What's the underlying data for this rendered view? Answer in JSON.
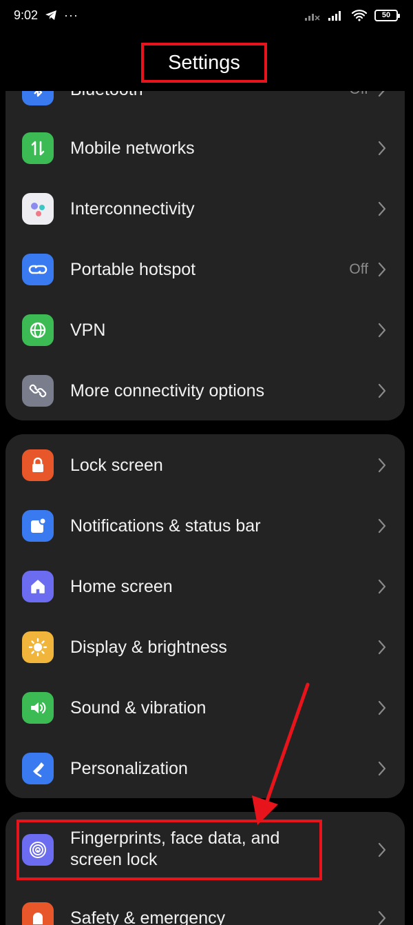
{
  "status_bar": {
    "time": "9:02",
    "dots": "···",
    "battery": "50"
  },
  "header": {
    "title": "Settings"
  },
  "group1": {
    "bluetooth": {
      "label": "Bluetooth",
      "value": "Off"
    },
    "mobile_networks": {
      "label": "Mobile networks"
    },
    "interconnectivity": {
      "label": "Interconnectivity"
    },
    "portable_hotspot": {
      "label": "Portable hotspot",
      "value": "Off"
    },
    "vpn": {
      "label": "VPN"
    },
    "more_connectivity": {
      "label": "More connectivity options"
    }
  },
  "group2": {
    "lock_screen": {
      "label": "Lock screen"
    },
    "notifications": {
      "label": "Notifications & status bar"
    },
    "home_screen": {
      "label": "Home screen"
    },
    "display": {
      "label": "Display & brightness"
    },
    "sound": {
      "label": "Sound & vibration"
    },
    "personalization": {
      "label": "Personalization"
    }
  },
  "group3": {
    "fingerprints": {
      "label_line1": "Fingerprints, face data, and",
      "label_line2": "screen lock"
    },
    "safety": {
      "label": "Safety & emergency"
    }
  },
  "colors": {
    "background": "#000000",
    "card": "#232323",
    "highlight": "#e8141b",
    "icon_blue": "#3a7af0",
    "icon_green": "#3cba54",
    "icon_orange": "#e8572a",
    "icon_purple": "#6b6cf0",
    "icon_yellow": "#f0b53a",
    "icon_gray": "#7a7d8c"
  }
}
